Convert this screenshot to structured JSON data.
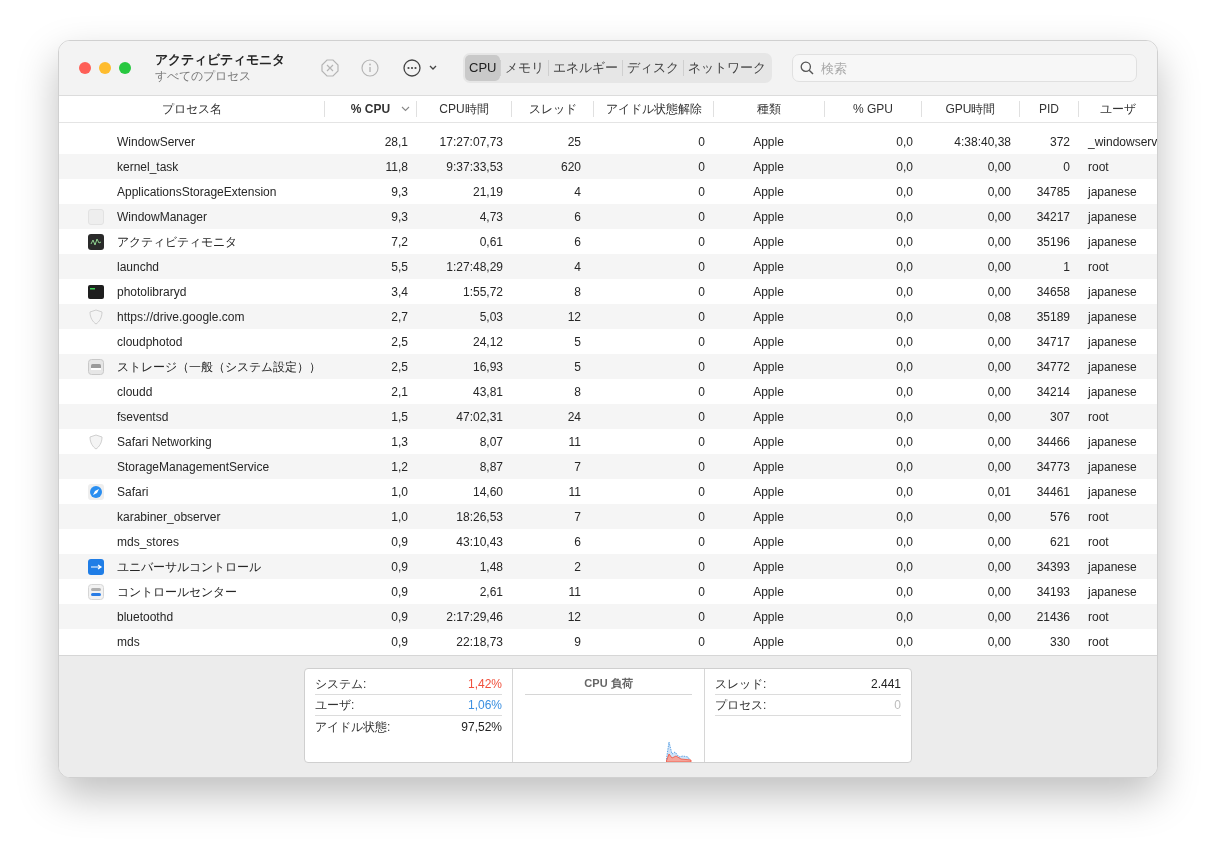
{
  "window": {
    "title": "アクティビティモニタ",
    "subtitle": "すべてのプロセス"
  },
  "tabs": [
    {
      "label": "CPU",
      "selected": true
    },
    {
      "label": "メモリ",
      "selected": false
    },
    {
      "label": "エネルギー",
      "selected": false
    },
    {
      "label": "ディスク",
      "selected": false
    },
    {
      "label": "ネットワーク",
      "selected": false
    }
  ],
  "search": {
    "placeholder": "検索"
  },
  "table": {
    "columns": [
      {
        "label": "プロセス名",
        "sorted": false
      },
      {
        "label": "% CPU",
        "sorted": true
      },
      {
        "label": "CPU時間",
        "sorted": false
      },
      {
        "label": "スレッド",
        "sorted": false
      },
      {
        "label": "アイドル状態解除",
        "sorted": false
      },
      {
        "label": "種類",
        "sorted": false
      },
      {
        "label": "% GPU",
        "sorted": false
      },
      {
        "label": "GPU時間",
        "sorted": false
      },
      {
        "label": "PID",
        "sorted": false
      },
      {
        "label": "ユーザ",
        "sorted": false
      }
    ],
    "rows": [
      {
        "kind": "none",
        "cells": [
          "WindowServer",
          "28,1",
          "17:27:07,73",
          "25",
          "0",
          "Apple",
          "0,0",
          "4:38:40,38",
          "372",
          "_windowserv"
        ]
      },
      {
        "kind": "none",
        "cells": [
          "kernel_task",
          "11,8",
          "9:37:33,53",
          "620",
          "0",
          "Apple",
          "0,0",
          "0,00",
          "0",
          "root"
        ]
      },
      {
        "kind": "none",
        "cells": [
          "ApplicationsStorageExtension",
          "9,3",
          "21,19",
          "4",
          "0",
          "Apple",
          "0,0",
          "0,00",
          "34785",
          "japanese"
        ]
      },
      {
        "kind": "blank",
        "cells": [
          "WindowManager",
          "9,3",
          "4,73",
          "6",
          "0",
          "Apple",
          "0,0",
          "0,00",
          "34217",
          "japanese"
        ]
      },
      {
        "kind": "monitor",
        "cells": [
          "アクティビティモニタ",
          "7,2",
          "0,61",
          "6",
          "0",
          "Apple",
          "0,0",
          "0,00",
          "35196",
          "japanese"
        ]
      },
      {
        "kind": "none",
        "cells": [
          "launchd",
          "5,5",
          "1:27:48,29",
          "4",
          "0",
          "Apple",
          "0,0",
          "0,00",
          "1",
          "root"
        ]
      },
      {
        "kind": "terminal",
        "cells": [
          "photolibraryd",
          "3,4",
          "1:55,72",
          "8",
          "0",
          "Apple",
          "0,0",
          "0,00",
          "34658",
          "japanese"
        ]
      },
      {
        "kind": "shield",
        "cells": [
          "https://drive.google.com",
          "2,7",
          "5,03",
          "12",
          "0",
          "Apple",
          "0,0",
          "0,08",
          "35189",
          "japanese"
        ]
      },
      {
        "kind": "none",
        "cells": [
          "cloudphotod",
          "2,5",
          "24,12",
          "5",
          "0",
          "Apple",
          "0,0",
          "0,00",
          "34717",
          "japanese"
        ]
      },
      {
        "kind": "drive",
        "cells": [
          "ストレージ（一般（システム設定））",
          "2,5",
          "16,93",
          "5",
          "0",
          "Apple",
          "0,0",
          "0,00",
          "34772",
          "japanese"
        ]
      },
      {
        "kind": "none",
        "cells": [
          "cloudd",
          "2,1",
          "43,81",
          "8",
          "0",
          "Apple",
          "0,0",
          "0,00",
          "34214",
          "japanese"
        ]
      },
      {
        "kind": "none",
        "cells": [
          "fseventsd",
          "1,5",
          "47:02,31",
          "24",
          "0",
          "Apple",
          "0,0",
          "0,00",
          "307",
          "root"
        ]
      },
      {
        "kind": "shield",
        "cells": [
          "Safari Networking",
          "1,3",
          "8,07",
          "11",
          "0",
          "Apple",
          "0,0",
          "0,00",
          "34466",
          "japanese"
        ]
      },
      {
        "kind": "none",
        "cells": [
          "StorageManagementService",
          "1,2",
          "8,87",
          "7",
          "0",
          "Apple",
          "0,0",
          "0,00",
          "34773",
          "japanese"
        ]
      },
      {
        "kind": "compass",
        "cells": [
          "Safari",
          "1,0",
          "14,60",
          "11",
          "0",
          "Apple",
          "0,0",
          "0,01",
          "34461",
          "japanese"
        ]
      },
      {
        "kind": "none",
        "cells": [
          "karabiner_observer",
          "1,0",
          "18:26,53",
          "7",
          "0",
          "Apple",
          "0,0",
          "0,00",
          "576",
          "root"
        ]
      },
      {
        "kind": "none",
        "cells": [
          "mds_stores",
          "0,9",
          "43:10,43",
          "6",
          "0",
          "Apple",
          "0,0",
          "0,00",
          "621",
          "root"
        ]
      },
      {
        "kind": "universal",
        "cells": [
          "ユニバーサルコントロール",
          "0,9",
          "1,48",
          "2",
          "0",
          "Apple",
          "0,0",
          "0,00",
          "34393",
          "japanese"
        ]
      },
      {
        "kind": "toggles",
        "cells": [
          "コントロールセンター",
          "0,9",
          "2,61",
          "11",
          "0",
          "Apple",
          "0,0",
          "0,00",
          "34193",
          "japanese"
        ]
      },
      {
        "kind": "none",
        "cells": [
          "bluetoothd",
          "0,9",
          "2:17:29,46",
          "12",
          "0",
          "Apple",
          "0,0",
          "0,00",
          "21436",
          "root"
        ]
      },
      {
        "kind": "none",
        "cells": [
          "mds",
          "0,9",
          "22:18,73",
          "9",
          "0",
          "Apple",
          "0,0",
          "0,00",
          "330",
          "root"
        ]
      }
    ]
  },
  "summary": {
    "stats": [
      {
        "label": "システム:",
        "value": "1,42%",
        "color": "#f0503c"
      },
      {
        "label": "ユーザ:",
        "value": "1,06%",
        "color": "#3b8fe0"
      },
      {
        "label": "アイドル状態:",
        "value": "97,52%",
        "color": "#222222"
      }
    ],
    "chart_title": "CPU 負荷",
    "counts": [
      {
        "label": "スレッド:",
        "value": "2.441",
        "disabled": false
      },
      {
        "label": "プロセス:",
        "value": "0",
        "disabled": true
      }
    ]
  }
}
